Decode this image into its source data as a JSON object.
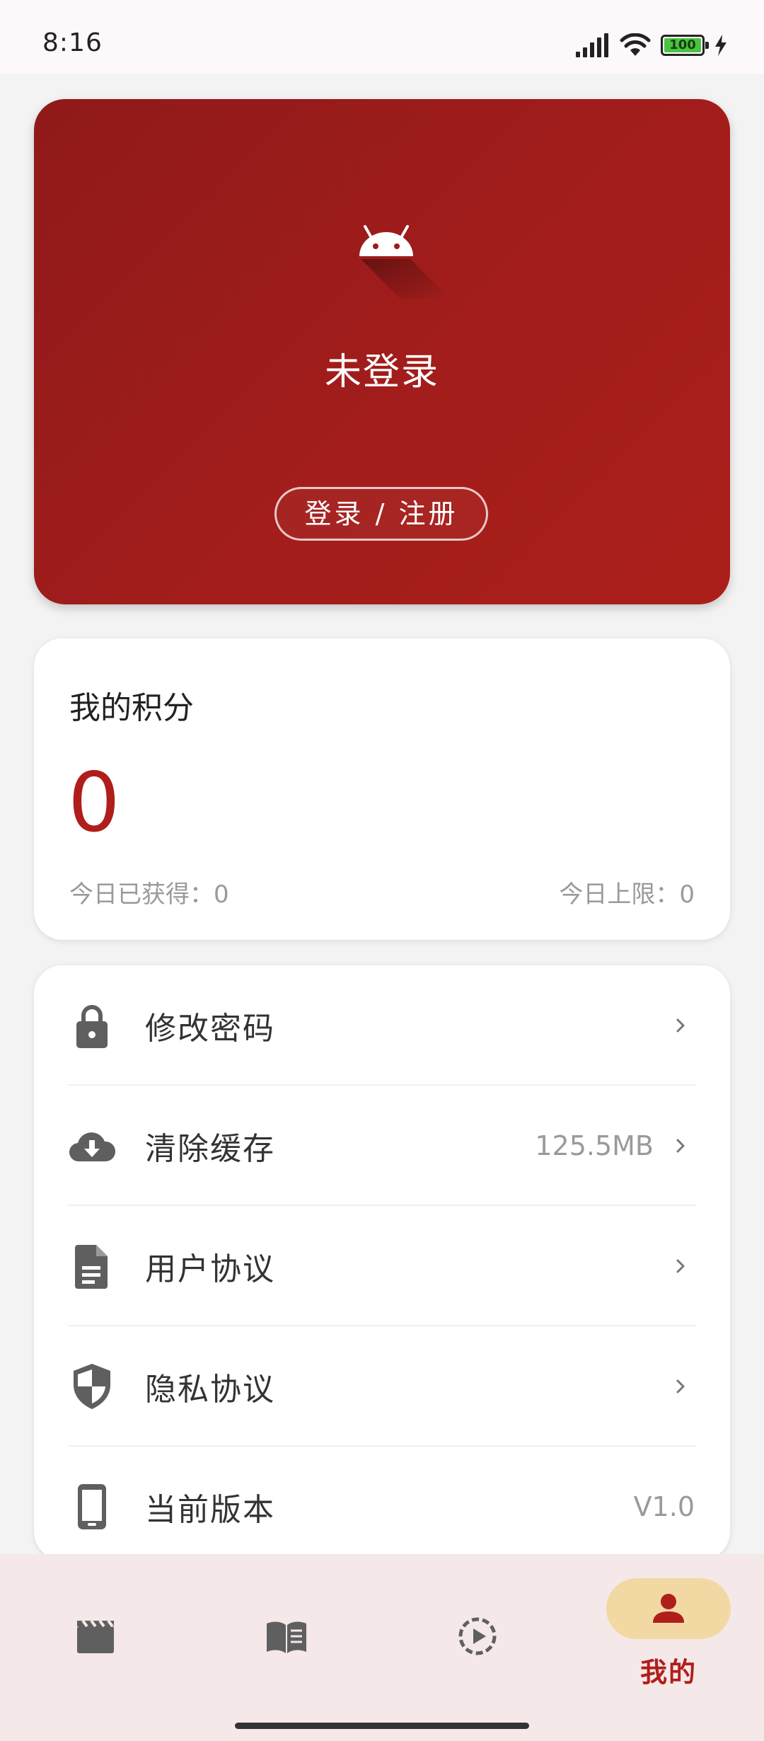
{
  "status_bar": {
    "time": "8:16",
    "battery_level": "100",
    "icons": [
      "signal-icon",
      "wifi-icon",
      "battery-icon",
      "charging-icon"
    ]
  },
  "profile": {
    "avatar_icon": "android-icon",
    "status_text": "未登录",
    "login_button_label": "登录 / 注册"
  },
  "points": {
    "title": "我的积分",
    "value": "0",
    "today_earned": "今日已获得：0",
    "today_limit": "今日上限：0"
  },
  "menu": {
    "items": [
      {
        "label": "修改密码",
        "icon": "lock-icon",
        "value": "",
        "arrow": true
      },
      {
        "label": "清除缓存",
        "icon": "cloud-download-icon",
        "value": "125.5MB",
        "arrow": true
      },
      {
        "label": "用户协议",
        "icon": "document-icon",
        "value": "",
        "arrow": true
      },
      {
        "label": "隐私协议",
        "icon": "shield-icon",
        "value": "",
        "arrow": true
      },
      {
        "label": "当前版本",
        "icon": "phone-icon",
        "value": "V1.0",
        "arrow": false
      }
    ]
  },
  "bottom_nav": {
    "items": [
      {
        "icon": "clapperboard-icon",
        "label": ""
      },
      {
        "icon": "book-icon",
        "label": ""
      },
      {
        "icon": "play-circle-icon",
        "label": ""
      },
      {
        "icon": "person-icon",
        "label": "我的",
        "selected": true
      }
    ]
  },
  "colors": {
    "accent": "#b01e1b",
    "card_gradient_start": "#8f1a1a",
    "card_gradient_end": "#ab1e19",
    "selected_pill": "#f2d9a4",
    "nav_background": "#f5e8e8",
    "icon_gray": "#5f5f5f"
  }
}
